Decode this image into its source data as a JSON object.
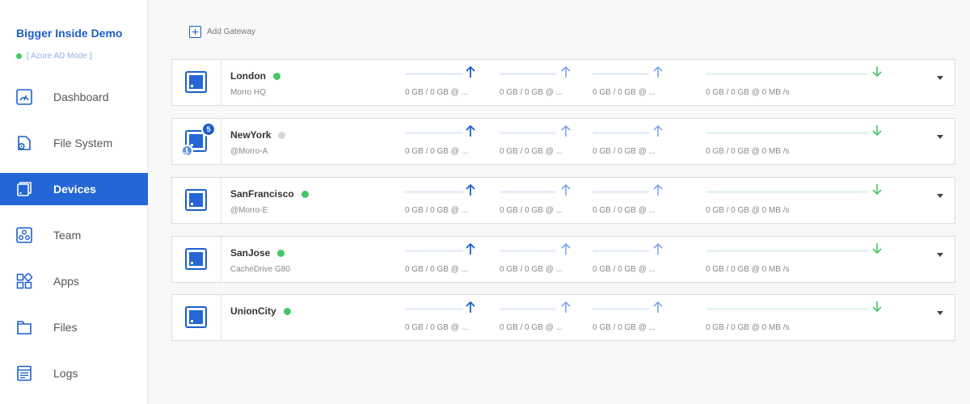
{
  "sidebar": {
    "org_name": "Bigger Inside Demo",
    "mode": "[ Azure AD Mode ]",
    "items": [
      {
        "label": "Dashboard",
        "icon": "gauge-icon"
      },
      {
        "label": "File System",
        "icon": "file-system-icon"
      },
      {
        "label": "Devices",
        "icon": "devices-icon",
        "active": true
      },
      {
        "label": "Team",
        "icon": "team-icon"
      },
      {
        "label": "Apps",
        "icon": "apps-icon"
      },
      {
        "label": "Files",
        "icon": "folder-icon"
      },
      {
        "label": "Logs",
        "icon": "logs-icon"
      }
    ]
  },
  "toolbar": {
    "add_gateway_label": "Add Gateway"
  },
  "colors": {
    "accent": "#2466d5",
    "online": "#44c767",
    "offline": "#d6d6d6",
    "upload_arrow": "#1c5fc9",
    "download_arrow": "#44c767"
  },
  "devices": [
    {
      "name": "London",
      "subtitle": "Morro HQ",
      "status": "online",
      "metrics": [
        "0 GB / 0 GB @ ...",
        "0 GB / 0 GB @ ...",
        "0 GB / 0 GB @ ...",
        "0 GB / 0 GB @ 0 MB /s"
      ]
    },
    {
      "name": "NewYork",
      "subtitle": "@Morro-A",
      "status": "offline",
      "badge": "5",
      "metrics": [
        "0 GB / 0 GB @ ...",
        "0 GB / 0 GB @ ...",
        "0 GB / 0 GB @ ...",
        "0 GB / 0 GB @ 0 MB /s"
      ]
    },
    {
      "name": "SanFrancisco",
      "subtitle": "@Morro-E",
      "status": "online",
      "metrics": [
        "0 GB / 0 GB @ ...",
        "0 GB / 0 GB @ ...",
        "0 GB / 0 GB @ ...",
        "0 GB / 0 GB @ 0 MB /s"
      ]
    },
    {
      "name": "SanJose",
      "subtitle": "CacheDrive G80",
      "status": "online",
      "metrics": [
        "0 GB / 0 GB @ ...",
        "0 GB / 0 GB @ ...",
        "0 GB / 0 GB @ ...",
        "0 GB / 0 GB @ 0 MB /s"
      ]
    },
    {
      "name": "UnionCity",
      "subtitle": "",
      "status": "online",
      "metrics": [
        "0 GB / 0 GB @ ...",
        "0 GB / 0 GB @ ...",
        "0 GB / 0 GB @ ...",
        "0 GB / 0 GB @ 0 MB /s"
      ]
    }
  ]
}
